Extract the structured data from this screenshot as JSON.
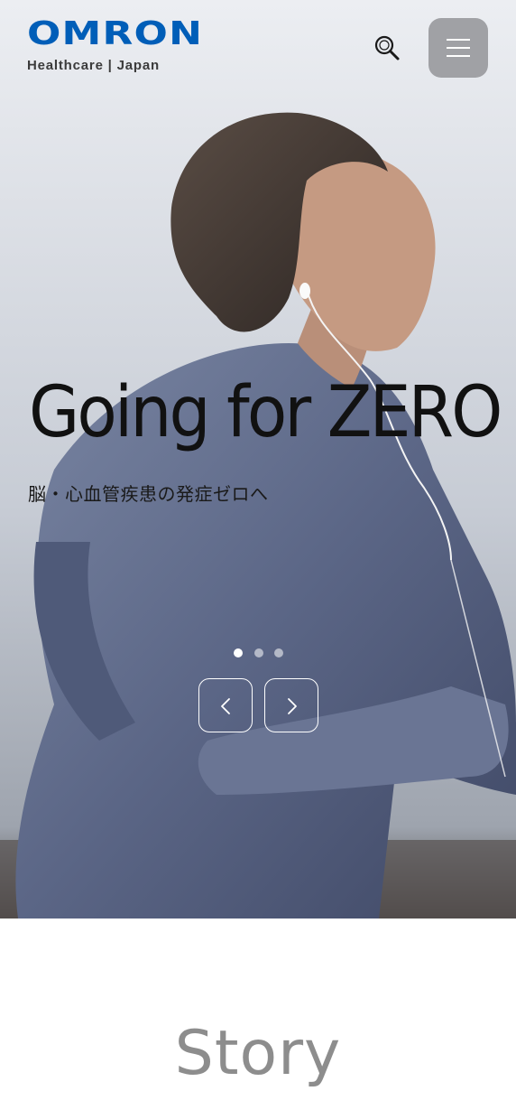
{
  "header": {
    "brand": "OMRON",
    "brand_sub": "Healthcare | Japan",
    "brand_color": "#005eb8",
    "search_icon": "search-icon",
    "menu_icon": "hamburger-menu-icon"
  },
  "hero": {
    "headline": "Going for ZERO",
    "subline": "脳・心血管疾患の発症ゼロへ",
    "slides_total": 3,
    "active_slide": 1,
    "prev_icon": "chevron-left-icon",
    "next_icon": "chevron-right-icon"
  },
  "story": {
    "heading": "Story"
  }
}
